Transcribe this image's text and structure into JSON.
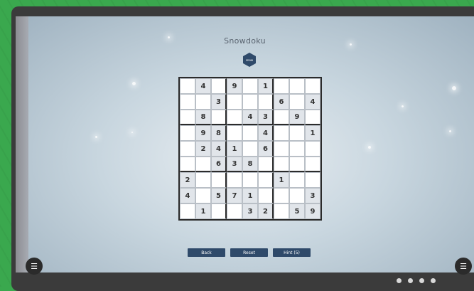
{
  "game": {
    "title": "Snowdoku",
    "badge_text": "snow"
  },
  "grid": [
    [
      null,
      4,
      null,
      9,
      null,
      1,
      null,
      null,
      null
    ],
    [
      null,
      null,
      3,
      null,
      null,
      null,
      6,
      null,
      4
    ],
    [
      null,
      8,
      null,
      null,
      4,
      3,
      null,
      9,
      null
    ],
    [
      null,
      9,
      8,
      null,
      null,
      4,
      null,
      null,
      1
    ],
    [
      null,
      2,
      4,
      1,
      null,
      6,
      null,
      null,
      null
    ],
    [
      null,
      null,
      6,
      3,
      8,
      null,
      null,
      null,
      null
    ],
    [
      2,
      null,
      null,
      null,
      null,
      null,
      1,
      null,
      null
    ],
    [
      4,
      null,
      5,
      7,
      1,
      null,
      null,
      null,
      3
    ],
    [
      null,
      1,
      null,
      null,
      3,
      2,
      null,
      5,
      9
    ]
  ],
  "buttons": {
    "back": "Back",
    "reset": "Reset",
    "hint": "Hint (5)"
  },
  "menu_icon": "☰",
  "pager": {
    "pages": 4,
    "current": 1
  }
}
